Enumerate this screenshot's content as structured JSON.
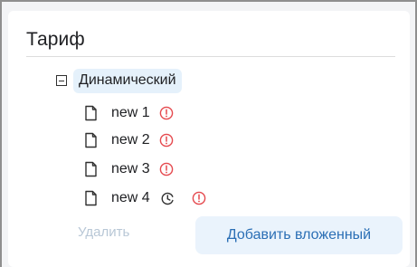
{
  "panel": {
    "title": "Тариф"
  },
  "tree": {
    "root": {
      "label": "Динамический",
      "expanded": true
    },
    "items": [
      {
        "label": "new 1",
        "icon": "file-icon",
        "status_icons": [
          "warning-icon"
        ]
      },
      {
        "label": "new 2",
        "icon": "file-icon",
        "status_icons": [
          "warning-icon"
        ]
      },
      {
        "label": "new 3",
        "icon": "file-icon",
        "status_icons": [
          "warning-icon"
        ]
      },
      {
        "label": "new 4",
        "icon": "file-icon",
        "status_icons": [
          "clock-icon",
          "warning-icon"
        ]
      }
    ]
  },
  "actions": {
    "delete_label": "Удалить",
    "add_nested_label": "Добавить вложенный"
  },
  "colors": {
    "selection_bg": "#e5f1fb",
    "warning": "#e5484d",
    "primary_text": "#2b6fb5",
    "disabled_text": "#b8c7d6",
    "button_bg": "#eaf3fc"
  }
}
